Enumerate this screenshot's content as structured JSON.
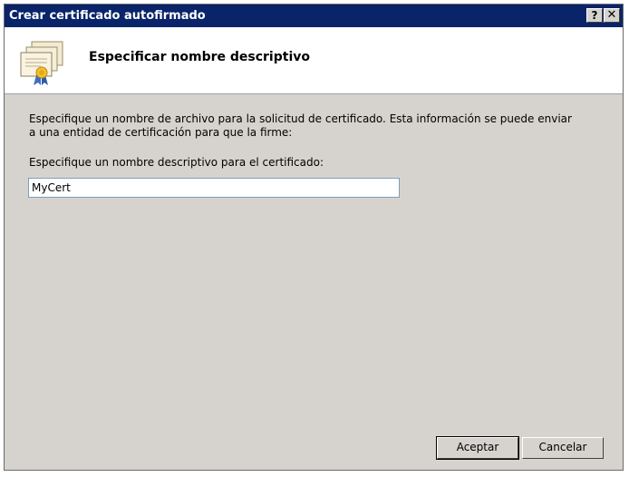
{
  "window": {
    "title": "Crear certificado autofirmado",
    "help_glyph": "?",
    "close_glyph": "✕"
  },
  "header": {
    "title": "Especificar nombre descriptivo",
    "icon": "certificate-icon"
  },
  "content": {
    "description": "Especifique un nombre de archivo para la solicitud de certificado. Esta información se puede enviar a una entidad de certificación para que la firme:",
    "field_label": "Especifique un nombre descriptivo para el certificado:",
    "field_value": "MyCert"
  },
  "buttons": {
    "accept": "Aceptar",
    "cancel": "Cancelar"
  },
  "colors": {
    "titlebar": "#0a246a",
    "dialog_bg": "#d6d3ce",
    "header_bg": "#ffffff"
  }
}
